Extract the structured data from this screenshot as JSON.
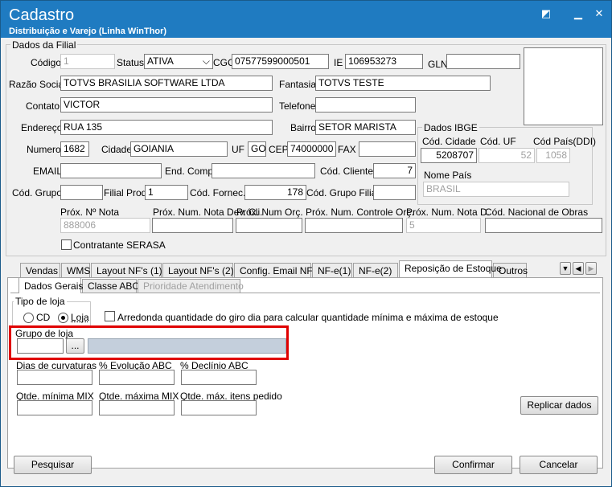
{
  "window": {
    "title": "Cadastro",
    "subtitle": "Distribuição e Varejo (Linha WinThor)"
  },
  "filial": {
    "group_title": "Dados da Filial",
    "codigo_label": "Código",
    "codigo_value": "1",
    "status_label": "Status",
    "status_value": "ATIVA",
    "cgc_label": "CGC",
    "cgc_value": "07577599000501",
    "ie_label": "IE",
    "ie_value": "106953273",
    "gln_label": "GLN",
    "gln_value": "",
    "razao_label": "Razão Social",
    "razao_value": "TOTVS BRASILIA SOFTWARE LTDA",
    "fantasia_label": "Fantasia",
    "fantasia_value": "TOTVS TESTE",
    "contato_label": "Contato",
    "contato_value": "VICTOR",
    "telefone_label": "Telefone",
    "telefone_value": "",
    "endereco_label": "Endereço",
    "endereco_value": "RUA 135",
    "bairro_label": "Bairro",
    "bairro_value": "SETOR MARISTA",
    "numero_label": "Numero",
    "numero_value": "1682",
    "cidade_label": "Cidade",
    "cidade_value": "GOIANIA",
    "uf_label": "UF",
    "uf_value": "GO",
    "cep_label": "CEP",
    "cep_value": "74000000",
    "fax_label": "FAX",
    "fax_value": "",
    "email_label": "EMAIL",
    "email_value": "",
    "endcomp_label": "End. Comp.",
    "endcomp_value": "",
    "codcliente_label": "Cód. Cliente",
    "codcliente_value": "7",
    "codgrupo_label": "Cód. Grupo",
    "codgrupo_value": "",
    "filialprod_label": "Filial Prod.",
    "filialprod_value": "1",
    "codfornec_label": "Cód. Fornec.",
    "codfornec_value": "178",
    "codgrupofilial_label": "Cód. Grupo Filial",
    "codgrupofilial_value": "",
    "proxnota_label": "Próx. Nº Nota",
    "proxnota_value": "888006",
    "proxdevcli_label": "Próx. Num. Nota Dev. Cli.",
    "proxdevcli_value": "",
    "proxorc_label": "Próx. Num Orç.",
    "proxorc_value": "",
    "proxcontroleorc_label": "Próx. Num. Controle Orç.",
    "proxcontroleorc_value": "",
    "proxnotad_label": "Próx. Num. Nota D.",
    "proxnotad_value": "5",
    "codobras_label": "Cód. Nacional de Obras",
    "codobras_value": "",
    "serasa_label": "Contratante SERASA"
  },
  "ibge": {
    "group_title": "Dados IBGE",
    "codcidade_label": "Cód. Cidade",
    "codcidade_value": "5208707",
    "coduf_label": "Cód. UF",
    "coduf_value": "52",
    "codpais_label": "Cód País(DDI)",
    "codpais_value": "1058",
    "nomepais_label": "Nome País",
    "nomepais_value": "BRASIL"
  },
  "tabs": [
    "Vendas",
    "WMS",
    "Layout NF's (1)",
    "Layout NF's (2)",
    "Config. Email NFe",
    "NF-e(1)",
    "NF-e(2)",
    "Reposição de Estoque",
    "Outros"
  ],
  "subtabs": [
    "Dados Gerais",
    "Classe ABC",
    "Prioridade Atendimento"
  ],
  "reposicao": {
    "tipo_loja_title": "Tipo de loja",
    "cd_label": "CD",
    "loja_label": "Loja",
    "arredonda_label": "Arredonda quantidade do giro dia  para calcular quantidade mínima e máxima de estoque",
    "grupo_loja_label": "Grupo de loja",
    "grupo_btn": "...",
    "dias_label": "Dias de curvaturas",
    "evolucao_label": "% Evolução ABC",
    "declinio_label": "% Declínio ABC",
    "qtde_min_label": "Qtde. mínima MIX",
    "qtde_max_label": "Qtde. máxima MIX",
    "qtde_itens_label": "Qtde. máx. itens pedido",
    "replicar_label": "Replicar dados"
  },
  "footer": {
    "pesquisar": "Pesquisar",
    "confirmar": "Confirmar",
    "cancelar": "Cancelar"
  },
  "colors": {
    "titlebar": "#1f7bc1",
    "highlight": "#e00000"
  }
}
